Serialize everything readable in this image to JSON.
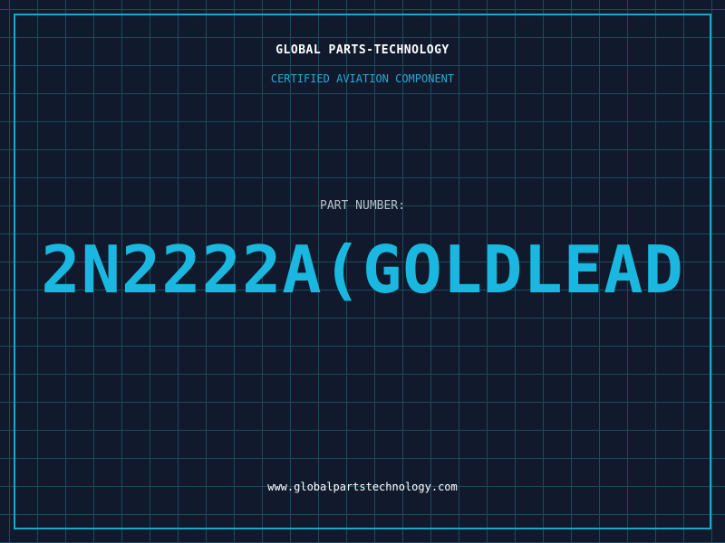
{
  "header": {
    "company": "GLOBAL PARTS-TECHNOLOGY",
    "tagline": "CERTIFIED AVIATION COMPONENT"
  },
  "part": {
    "label": "PART NUMBER:",
    "number": "2N2222A(GOLDLEAD"
  },
  "footer": {
    "website": "www.globalpartstechnology.com"
  },
  "colors": {
    "background": "#111a2c",
    "grid": "#1c4a5e",
    "accent": "#1ab8e0",
    "frame": "#18a8c8"
  }
}
